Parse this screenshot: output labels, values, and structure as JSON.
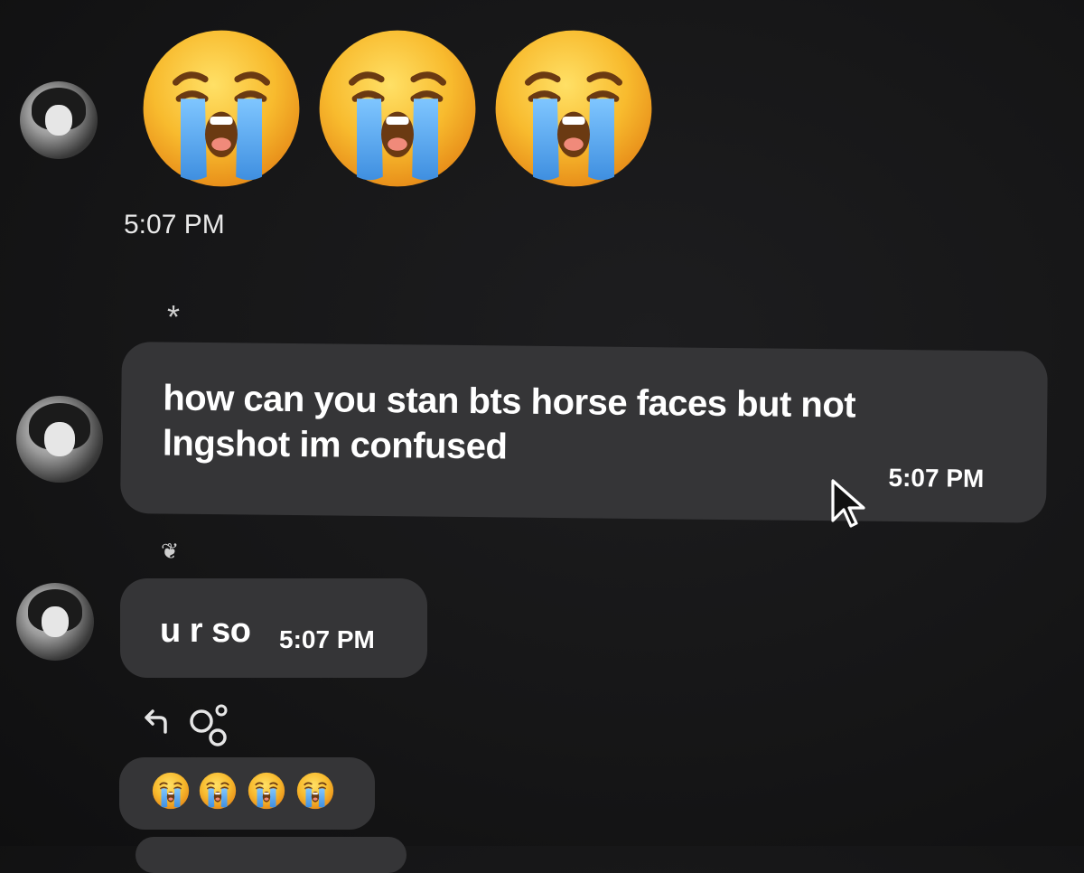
{
  "messages": [
    {
      "id": "emoji-message",
      "emoji": [
        "😭",
        "😭",
        "😭"
      ],
      "time": "5:07 PM"
    },
    {
      "id": "text-message-1",
      "marker": "*",
      "lines": [
        "how can you stan bts horse faces but not",
        "lngshot im confused"
      ],
      "time": "5:07 PM"
    },
    {
      "id": "text-message-2",
      "marker": "❦",
      "text": "u r so",
      "time": "5:07 PM"
    }
  ],
  "actions": {
    "reply_icon": "reply-arrow-icon",
    "reaction_icon": "add-reaction-icon"
  },
  "reactions": [
    "😭",
    "😭",
    "😭",
    "😭"
  ],
  "colors": {
    "background": "#161617",
    "bubble": "#353537",
    "text": "#ffffff",
    "emoji_yellow": "#f7b733",
    "tears": "#5ab0f0"
  }
}
